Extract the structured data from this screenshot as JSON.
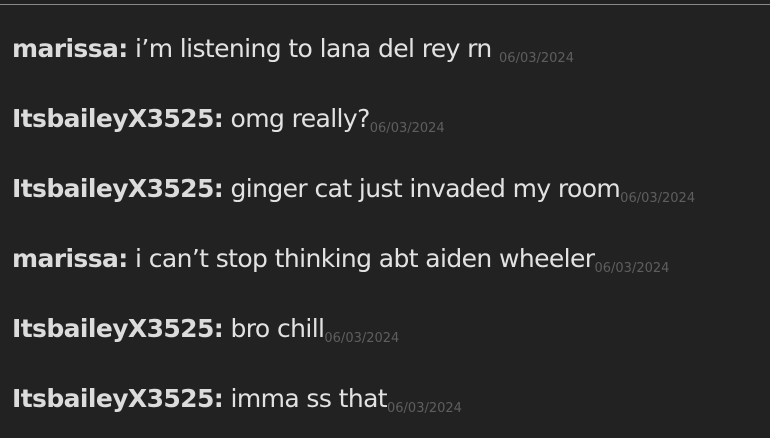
{
  "messages": [
    {
      "user": "marissa:",
      "text": "i’m listening to lana del rey rn",
      "time": "06/03/2024",
      "spaced": true
    },
    {
      "user": "ItsbaileyX3525:",
      "text": "omg really?",
      "time": "06/03/2024",
      "spaced": false
    },
    {
      "user": "ItsbaileyX3525:",
      "text": "ginger cat just invaded my room",
      "time": "06/03/2024",
      "spaced": false
    },
    {
      "user": "marissa:",
      "text": "i can’t stop thinking abt aiden wheeler",
      "time": "06/03/2024",
      "spaced": false
    },
    {
      "user": "ItsbaileyX3525:",
      "text": "bro chill",
      "time": "06/03/2024",
      "spaced": false
    },
    {
      "user": "ItsbaileyX3525:",
      "text": "imma ss that",
      "time": "06/03/2024",
      "spaced": false
    }
  ]
}
